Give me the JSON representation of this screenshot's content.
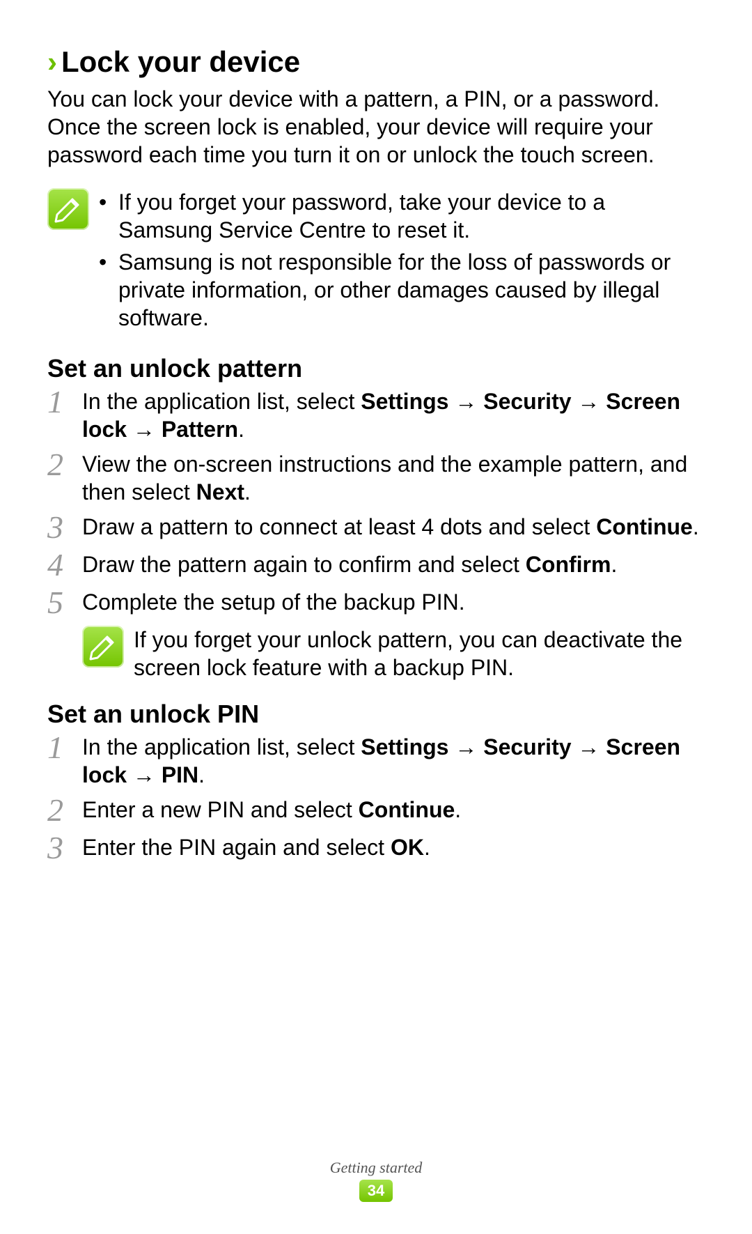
{
  "heading": "Lock your device",
  "intro": "You can lock your device with a pattern, a PIN, or a password. Once the screen lock is enabled, your device will require your password each time you turn it on or unlock the touch screen.",
  "note1": {
    "items": [
      "If you forget your password, take your device to a Samsung Service Centre to reset it.",
      "Samsung is not responsible for the loss of passwords or private information, or other damages caused by illegal software."
    ]
  },
  "pattern": {
    "heading": "Set an unlock pattern",
    "steps": [
      {
        "n": "1",
        "pre": "In the application list, select ",
        "bold": "Settings → Security → Screen lock → Pattern",
        "post": "."
      },
      {
        "n": "2",
        "pre": "View the on-screen instructions and the example pattern, and then select ",
        "bold": "Next",
        "post": "."
      },
      {
        "n": "3",
        "pre": "Draw a pattern to connect at least 4 dots and select ",
        "bold": "Continue",
        "post": "."
      },
      {
        "n": "4",
        "pre": "Draw the pattern again to confirm and select ",
        "bold": "Confirm",
        "post": "."
      },
      {
        "n": "5",
        "pre": "Complete the setup of the backup PIN.",
        "bold": "",
        "post": ""
      }
    ],
    "note": "If you forget your unlock pattern, you can deactivate the screen lock feature with a backup PIN."
  },
  "pin": {
    "heading": "Set an unlock PIN",
    "steps": [
      {
        "n": "1",
        "pre": "In the application list, select ",
        "bold": "Settings → Security → Screen lock → PIN",
        "post": "."
      },
      {
        "n": "2",
        "pre": "Enter a new PIN and select ",
        "bold": "Continue",
        "post": "."
      },
      {
        "n": "3",
        "pre": "Enter the PIN again and select ",
        "bold": "OK",
        "post": "."
      }
    ]
  },
  "footer": {
    "section": "Getting started",
    "page": "34"
  }
}
